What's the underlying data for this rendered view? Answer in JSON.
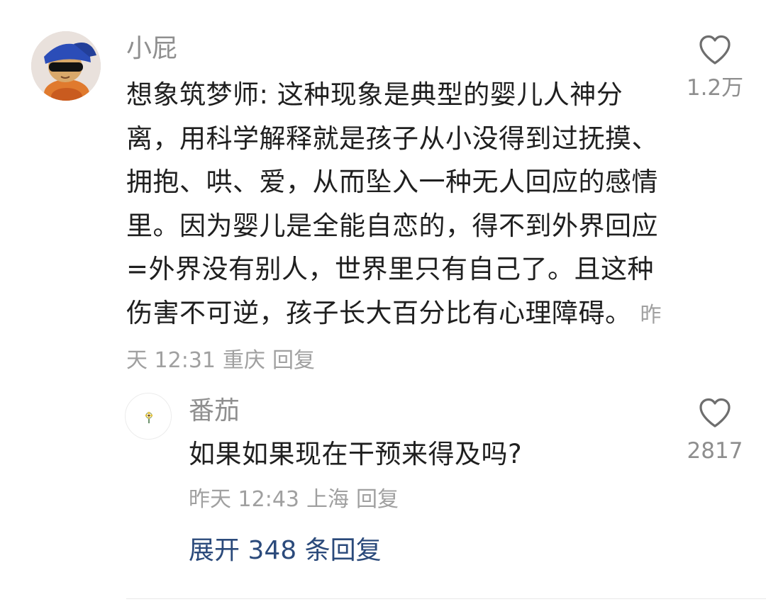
{
  "main_comment": {
    "username": "小屁",
    "text": "想象筑梦师: 这种现象是典型的婴儿人神分离，用科学解释就是孩子从小没得到过抚摸、拥抱、哄、爱，从而坠入一种无人回应的感情里。因为婴儿是全能自恋的，得不到外界回应=外界没有别人，世界里只有自己了。且这种伤害不可逆，孩子长大百分比有心理障碍。",
    "time": "昨天 12:31",
    "location": "重庆",
    "reply_label": "回复",
    "likes": "1.2万",
    "avatar_icon": "avatar-cat-with-beanie-and-sunglasses"
  },
  "reply_comment": {
    "username": "番茄",
    "text": "如果如果现在干预来得及吗?",
    "time": "昨天 12:43",
    "location": "上海",
    "reply_label": "回复",
    "likes": "2817",
    "avatar_icon": "avatar-small-flower"
  },
  "expand_replies": "展开 348 条回复",
  "colors": {
    "username": "#8f8f8f",
    "body_text": "#1f1f1f",
    "meta_text": "#a0a0a0",
    "expand_link": "#2b4a7b",
    "divider": "#e8e8e8"
  },
  "icons": {
    "like": "heart-outline-icon"
  }
}
